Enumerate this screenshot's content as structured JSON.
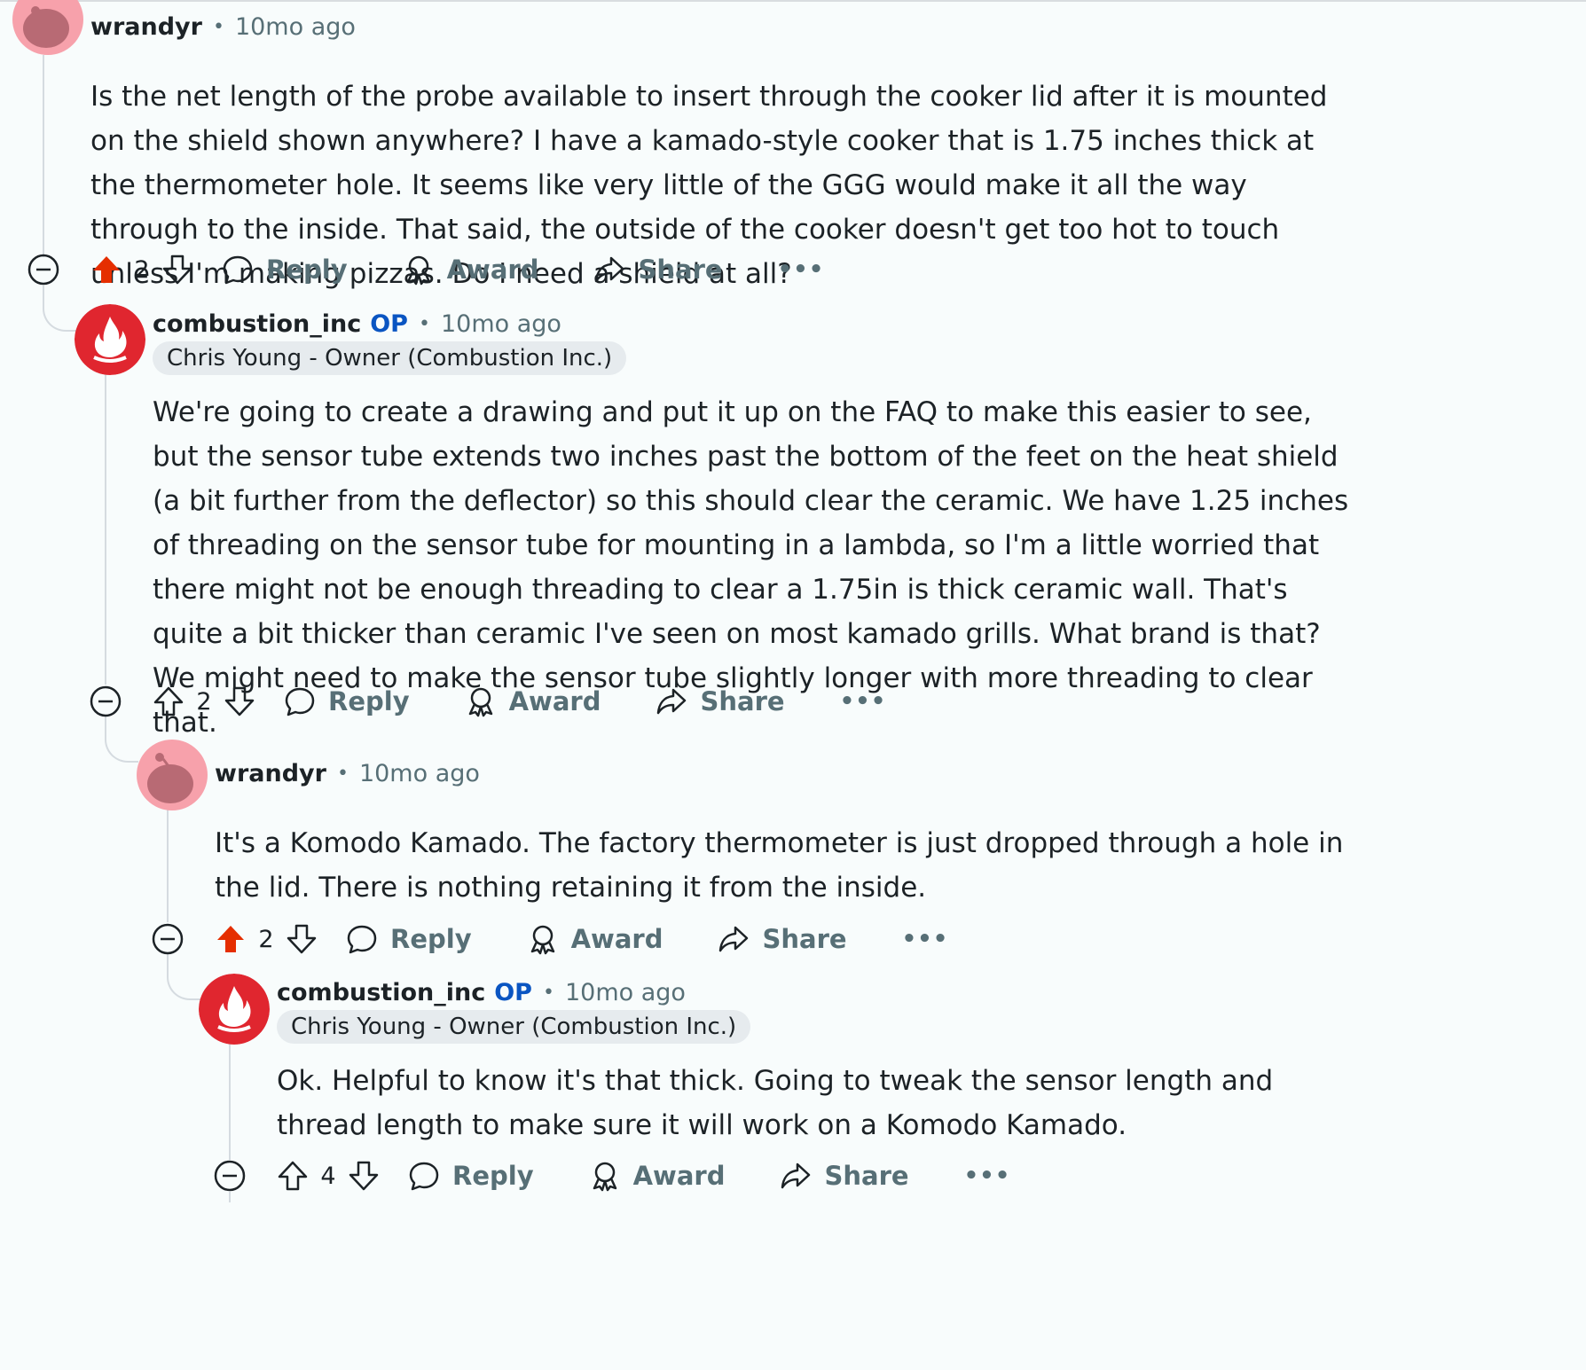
{
  "colors": {
    "upvoted": "#e52e00",
    "op_blue": "#0a55c2",
    "meta_gray": "#576f76",
    "thread_line": "#d5dbe0",
    "flair_bg": "#e6ebee"
  },
  "labels": {
    "reply": "Reply",
    "award": "Award",
    "share": "Share",
    "more": "•••",
    "separator": "•",
    "op": "OP"
  },
  "comments": [
    {
      "author": "wrandyr",
      "time": "10mo ago",
      "is_op": false,
      "flair": "",
      "body": "Is the net length of the probe available to insert through the cooker lid after it is mounted on the shield shown anywhere? I have a kamado-style cooker that is 1.75 inches thick at the thermometer hole. It seems like very little of the GGG would make it all the way through to the inside. That said, the outside of the cooker doesn't get too hot to touch unless I'm making pizzas. Do I need a shield at all?",
      "score": "2",
      "upvoted": true,
      "avatar_icon": "snoo-avatar-icon"
    },
    {
      "author": "combustion_inc",
      "time": "10mo ago",
      "is_op": true,
      "flair": "Chris Young - Owner (Combustion Inc.)",
      "body": "We're going to create a drawing and put it up on the FAQ to make this easier to see, but the sensor tube extends two inches past the bottom of the feet on the heat shield (a bit further from the deflector) so this should clear the ceramic. We have 1.25 inches of threading on the sensor tube for mounting in a lambda, so I'm a little worried that there might not be enough threading to clear a 1.75in is thick ceramic wall. That's quite a bit thicker than ceramic I've seen on most kamado grills. What brand is that? We might need to make the sensor tube slightly longer with more threading to clear that.",
      "score": "2",
      "upvoted": false,
      "avatar_icon": "flame-logo-icon"
    },
    {
      "author": "wrandyr",
      "time": "10mo ago",
      "is_op": false,
      "flair": "",
      "body": "It's a Komodo Kamado. The factory thermometer is just dropped through a hole in the lid. There is nothing retaining it from the inside.",
      "score": "2",
      "upvoted": true,
      "avatar_icon": "snoo-avatar-icon"
    },
    {
      "author": "combustion_inc",
      "time": "10mo ago",
      "is_op": true,
      "flair": "Chris Young - Owner (Combustion Inc.)",
      "body": "Ok. Helpful to know it's that thick. Going to tweak the sensor length and thread length to make sure it will work on a Komodo Kamado.",
      "score": "4",
      "upvoted": false,
      "avatar_icon": "flame-logo-icon"
    }
  ]
}
